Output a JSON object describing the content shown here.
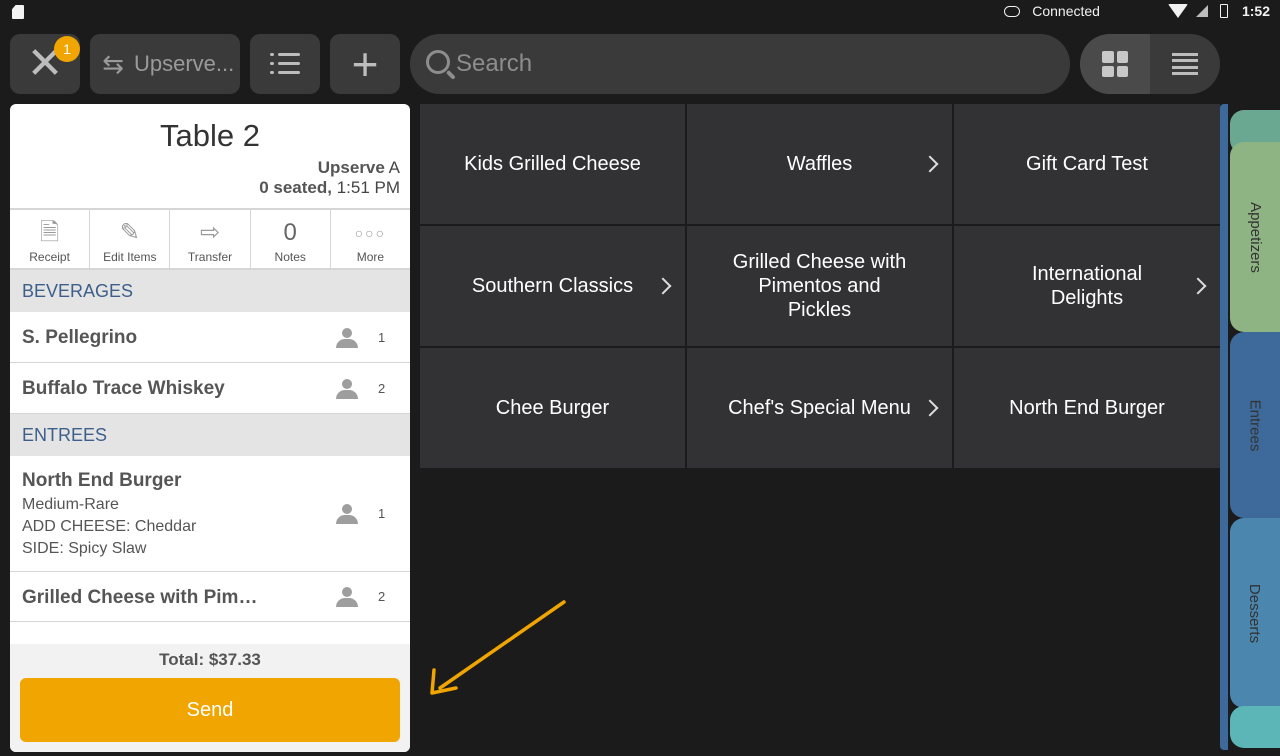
{
  "status_bar": {
    "connection": "Connected",
    "time": "1:52"
  },
  "toolbar": {
    "close_badge": "1",
    "server_label": "Upserve...",
    "search_placeholder": "Search"
  },
  "ticket": {
    "title": "Table 2",
    "server_name": "Upserve",
    "server_suffix": "A",
    "seated": "0 seated,",
    "time": "1:51 PM",
    "actions": [
      {
        "label": "Receipt",
        "icon": "receipt-icon"
      },
      {
        "label": "Edit Items",
        "icon": "edit-icon"
      },
      {
        "label": "Transfer",
        "icon": "transfer-arrow-icon"
      },
      {
        "label": "Notes",
        "count": "0"
      },
      {
        "label": "More",
        "icon": "more-dots-icon"
      }
    ],
    "sections": [
      {
        "name": "BEVERAGES",
        "items": [
          {
            "name": "S. Pellegrino",
            "seat": "1",
            "mods": []
          },
          {
            "name": "Buffalo Trace Whiskey",
            "seat": "2",
            "mods": []
          }
        ]
      },
      {
        "name": "ENTREES",
        "items": [
          {
            "name": "North End Burger",
            "seat": "1",
            "mods": [
              "Medium-Rare",
              "ADD CHEESE: Cheddar",
              "SIDE: Spicy Slaw"
            ]
          },
          {
            "name": "Grilled Cheese with Pime...",
            "seat": "2",
            "mods": []
          }
        ]
      }
    ],
    "total": "Total: $37.33",
    "send_label": "Send"
  },
  "menu_tiles": [
    {
      "label": "Kids Grilled Cheese",
      "has_submenu": false
    },
    {
      "label": "Waffles",
      "has_submenu": true
    },
    {
      "label": "Gift Card Test",
      "has_submenu": false
    },
    {
      "label": "Southern Classics",
      "has_submenu": true
    },
    {
      "label": "Grilled Cheese with Pimentos and Pickles",
      "has_submenu": false
    },
    {
      "label": "International Delights",
      "has_submenu": true
    },
    {
      "label": "Chee Burger",
      "has_submenu": false
    },
    {
      "label": "Chef's Special Menu",
      "has_submenu": true
    },
    {
      "label": "North End Burger",
      "has_submenu": false
    }
  ],
  "categories": [
    {
      "label": "",
      "color": "#6aa892"
    },
    {
      "label": "Appetizers",
      "color": "#8fb484"
    },
    {
      "label": "Entrees",
      "color": "#3d6a9a"
    },
    {
      "label": "Desserts",
      "color": "#4a86ae"
    },
    {
      "label": "",
      "color": "#5cb6b8"
    }
  ],
  "colors": {
    "accent": "#f0a500",
    "section_text": "#3d5f8a",
    "tile_bg": "#323234"
  }
}
